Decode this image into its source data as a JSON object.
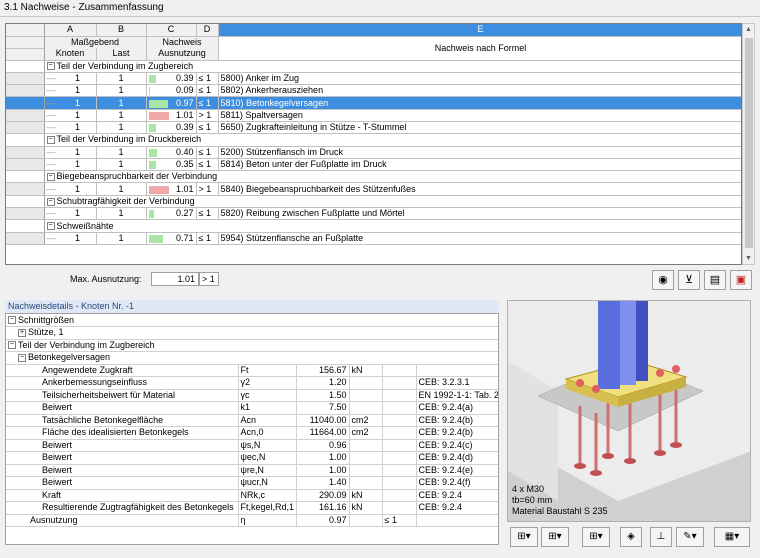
{
  "window": {
    "title": "3.1 Nachweise - Zusammenfassung"
  },
  "grid": {
    "col_letters": [
      "A",
      "B",
      "C",
      "D",
      "E"
    ],
    "col_headers": {
      "maszgebend": "Maßgebend",
      "knoten": "Knoten",
      "last": "Last",
      "nachweis": "Nachweis",
      "ausnutzung": "Ausnutzung",
      "formel": "Nachweis nach Formel"
    },
    "groups": [
      {
        "label": "Teil der Verbindung im Zugbereich",
        "rows": [
          {
            "knoten": "1",
            "last": "1",
            "value": "0.39",
            "ratio": 0.39,
            "op": "≤ 1",
            "desc": "5800) Anker im Zug"
          },
          {
            "knoten": "1",
            "last": "1",
            "value": "0.09",
            "ratio": 0.09,
            "op": "≤ 1",
            "desc": "5802) Ankerherausziehen"
          },
          {
            "knoten": "1",
            "last": "1",
            "value": "0.97",
            "ratio": 0.97,
            "op": "≤ 1",
            "desc": "5810) Betonkegelversagen",
            "selected": true
          },
          {
            "knoten": "1",
            "last": "1",
            "value": "1.01",
            "ratio": 1.01,
            "op": "> 1",
            "desc": "5811) Spaltversagen"
          },
          {
            "knoten": "1",
            "last": "1",
            "value": "0.39",
            "ratio": 0.39,
            "op": "≤ 1",
            "desc": "5650) Zugkrafteinleitung in Stütze - T-Stummel"
          }
        ]
      },
      {
        "label": "Teil der Verbindung im Druckbereich",
        "rows": [
          {
            "knoten": "1",
            "last": "1",
            "value": "0.40",
            "ratio": 0.4,
            "op": "≤ 1",
            "desc": "5200) Stützenflansch im Druck"
          },
          {
            "knoten": "1",
            "last": "1",
            "value": "0.35",
            "ratio": 0.35,
            "op": "≤ 1",
            "desc": "5814) Beton unter der Fußplatte im Druck"
          }
        ]
      },
      {
        "label": "Biegebeanspruchbarkeit der Verbindung",
        "rows": [
          {
            "knoten": "1",
            "last": "1",
            "value": "1.01",
            "ratio": 1.01,
            "op": "> 1",
            "desc": "5840) Biegebeanspruchbarkeit des Stützenfußes"
          }
        ]
      },
      {
        "label": "Schubtragfähigkeit der Verbindung",
        "rows": [
          {
            "knoten": "1",
            "last": "1",
            "value": "0.27",
            "ratio": 0.27,
            "op": "≤ 1",
            "desc": "5820) Reibung zwischen Fußplatte und Mörtel"
          }
        ]
      },
      {
        "label": "Schweißnähte",
        "rows": [
          {
            "knoten": "1",
            "last": "1",
            "value": "0.71",
            "ratio": 0.71,
            "op": "≤ 1",
            "desc": "5954) Stützenflansche an Fußplatte"
          }
        ]
      }
    ]
  },
  "max": {
    "label": "Max. Ausnutzung:",
    "value": "1.01",
    "op": "> 1"
  },
  "details": {
    "title": "Nachweisdetails - Knoten Nr. -1",
    "tree": [
      "Schnittgrößen",
      "Stütze, 1",
      "Teil der Verbindung im Zugbereich",
      "Betonkegelversagen"
    ],
    "rows": [
      {
        "name": "Angewendete Zugkraft",
        "sym": "Ft",
        "val": "156.67",
        "unit": "kN",
        "ref": ""
      },
      {
        "name": "Ankerbemessungseinfluss",
        "sym": "γ2",
        "val": "1.20",
        "unit": "",
        "ref": "CEB: 3.2.3.1"
      },
      {
        "name": "Teilsicherheitsbeiwert für Material",
        "sym": "γc",
        "val": "1.50",
        "unit": "",
        "ref": "EN 1992-1-1: Tab. 2"
      },
      {
        "name": "Beiwert",
        "sym": "k1",
        "val": "7.50",
        "unit": "",
        "ref": "CEB: 9.2.4(a)"
      },
      {
        "name": "Tatsächliche Betonkegelfläche",
        "sym": "Acn",
        "val": "11040.00",
        "unit": "cm2",
        "ref": "CEB: 9.2.4(b)"
      },
      {
        "name": "Fläche des idealisierten Betonkegels",
        "sym": "Acn,0",
        "val": "11664.00",
        "unit": "cm2",
        "ref": "CEB: 9.2.4(b)"
      },
      {
        "name": "Beiwert",
        "sym": "ψs,N",
        "val": "0.96",
        "unit": "",
        "ref": "CEB: 9.2.4(c)"
      },
      {
        "name": "Beiwert",
        "sym": "ψec,N",
        "val": "1.00",
        "unit": "",
        "ref": "CEB: 9.2.4(d)"
      },
      {
        "name": "Beiwert",
        "sym": "ψre,N",
        "val": "1.00",
        "unit": "",
        "ref": "CEB: 9.2.4(e)"
      },
      {
        "name": "Beiwert",
        "sym": "ψucr,N",
        "val": "1.40",
        "unit": "",
        "ref": "CEB: 9.2.4(f)"
      },
      {
        "name": "Kraft",
        "sym": "NRk,c",
        "val": "290.09",
        "unit": "kN",
        "ref": "CEB: 9.2.4"
      },
      {
        "name": "Resultierende Zugtragfähigkeit des Betonkegels",
        "sym": "Ft,kegel,Rd,1",
        "val": "161.16",
        "unit": "kN",
        "ref": "CEB: 9.2.4"
      }
    ],
    "ausnutzung": {
      "name": "Ausnutzung",
      "sym": "η",
      "val": "0.97",
      "op": "≤ 1"
    }
  },
  "view": {
    "line1": "4 x M30",
    "line2": "tb=60 mm",
    "line3": "Material Baustahl S 235"
  },
  "colors": {
    "accent": "#3d8ee0",
    "ok": "#a8e6a8",
    "fail": "#f0a8a8"
  }
}
